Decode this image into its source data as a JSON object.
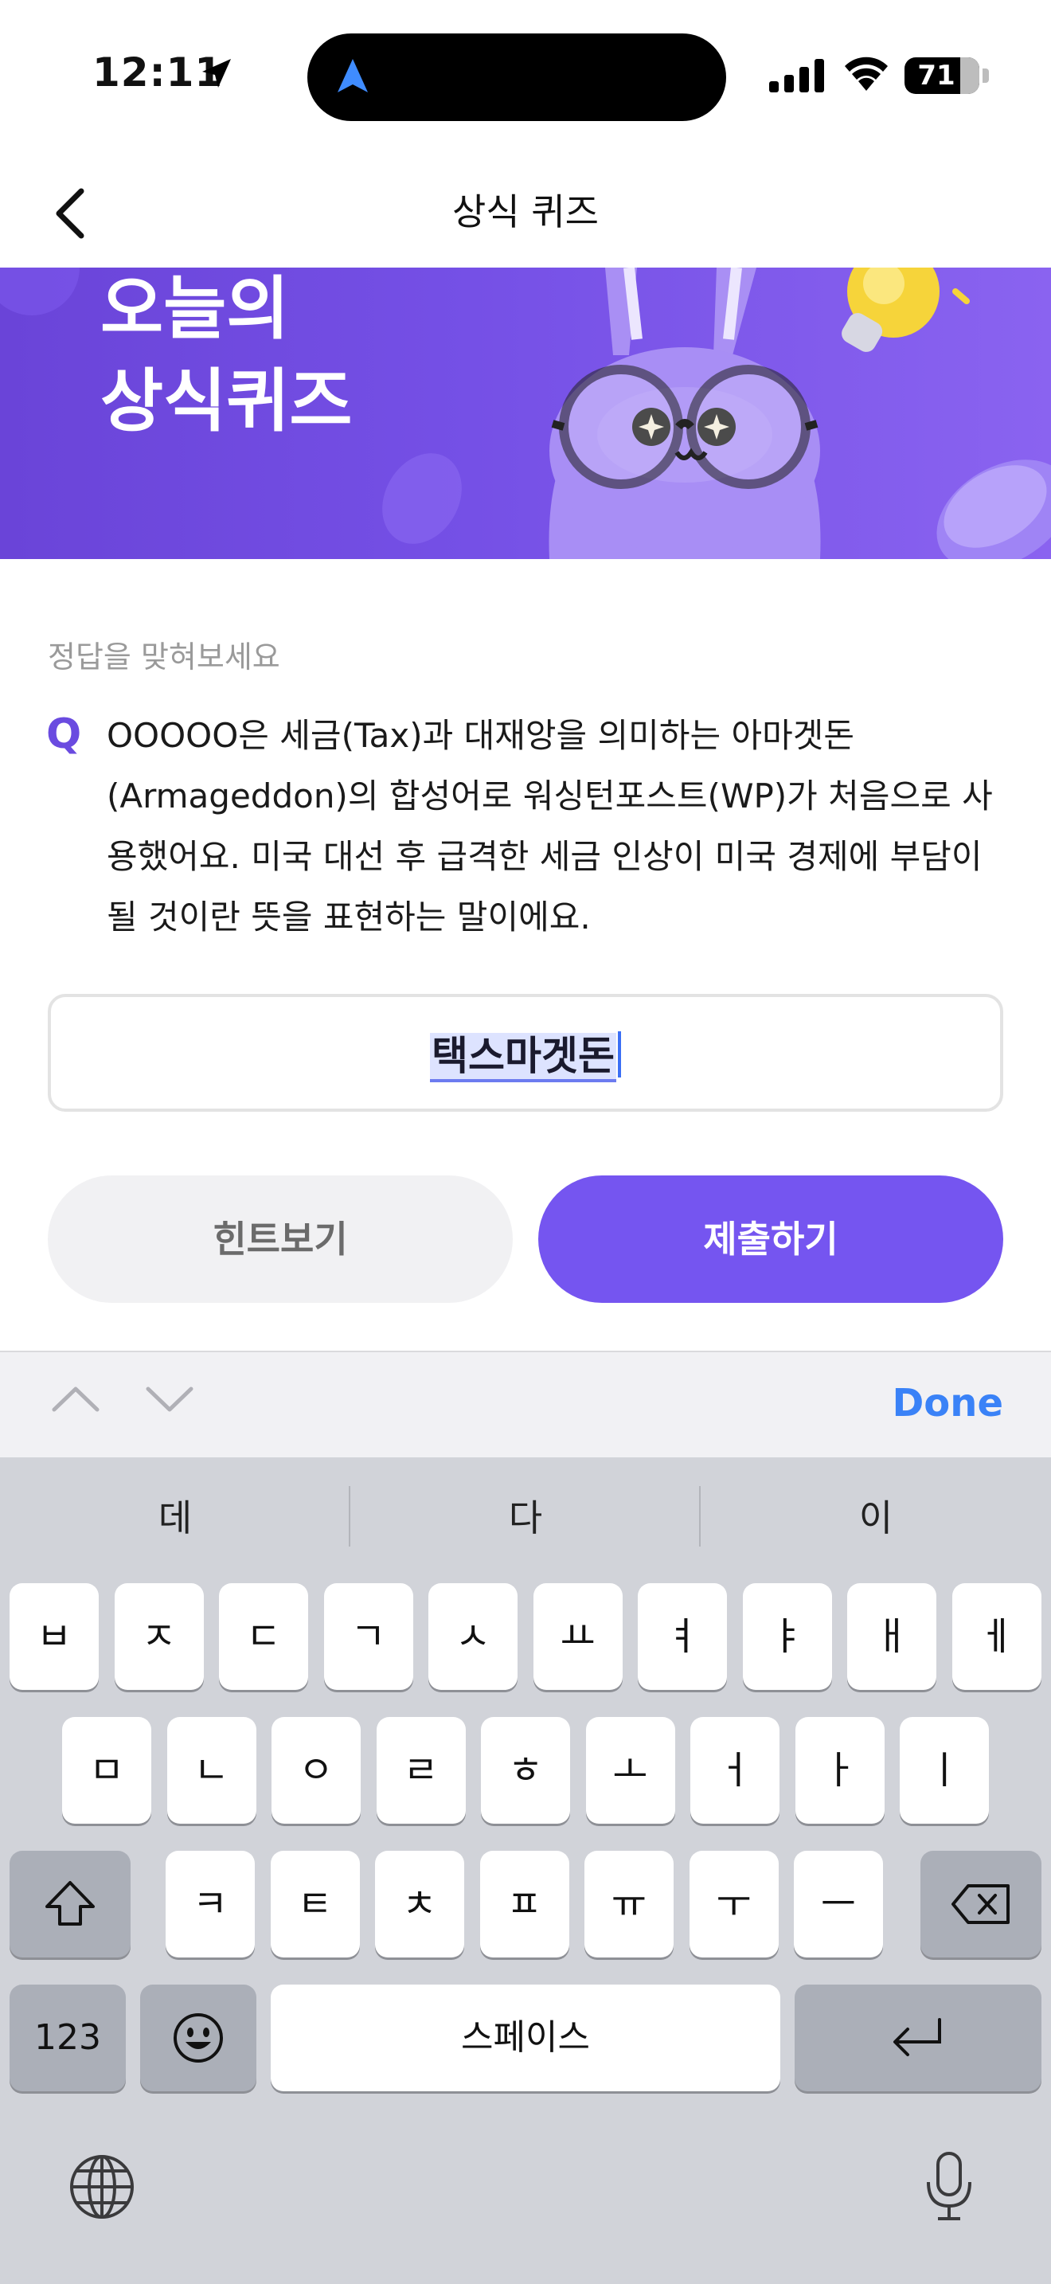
{
  "status_bar": {
    "time": "12:11",
    "battery": "71",
    "battery_level": 0.71
  },
  "nav": {
    "title": "상식 퀴즈"
  },
  "banner": {
    "title_line1": "오늘의",
    "title_line2": "상식퀴즈"
  },
  "quiz": {
    "prompt": "정답을 맞혀보세요",
    "q_mark": "Q",
    "question": "OOOOO은 세금(Tax)과 대재앙을 의미하는 아마겟돈(Armageddon)의 합성어로 워싱턴포스트(WP)가 처음으로 사용했어요. 미국 대선 후 급격한 세금 인상이 미국 경제에 부담이 될 것이란 뜻을 표현하는 말이에요.",
    "answer_value": "택스마겟돈",
    "hint_label": "힌트보기",
    "submit_label": "제출하기"
  },
  "keyboard_toolbar": {
    "done_label": "Done"
  },
  "keyboard": {
    "suggestions": [
      "데",
      "다",
      "이"
    ],
    "row1": [
      "ㅂ",
      "ㅈ",
      "ㄷ",
      "ㄱ",
      "ㅅ",
      "ㅛ",
      "ㅕ",
      "ㅑ",
      "ㅐ",
      "ㅔ"
    ],
    "row2": [
      "ㅁ",
      "ㄴ",
      "ㅇ",
      "ㄹ",
      "ㅎ",
      "ㅗ",
      "ㅓ",
      "ㅏ",
      "ㅣ"
    ],
    "row3": [
      "ㅋ",
      "ㅌ",
      "ㅊ",
      "ㅍ",
      "ㅠ",
      "ㅜ",
      "ㅡ"
    ],
    "numbers_label": "123",
    "space_label": "스페이스"
  },
  "colors": {
    "accent": "#7555f0",
    "banner": "#6a44d8",
    "done": "#3a82f7"
  },
  "icons": [
    "location-arrow-icon",
    "signal-icon",
    "wifi-icon",
    "battery-icon",
    "back-chevron-icon",
    "chevron-up-icon",
    "chevron-down-icon",
    "shift-icon",
    "delete-icon",
    "emoji-icon",
    "return-icon",
    "globe-icon",
    "microphone-icon"
  ]
}
